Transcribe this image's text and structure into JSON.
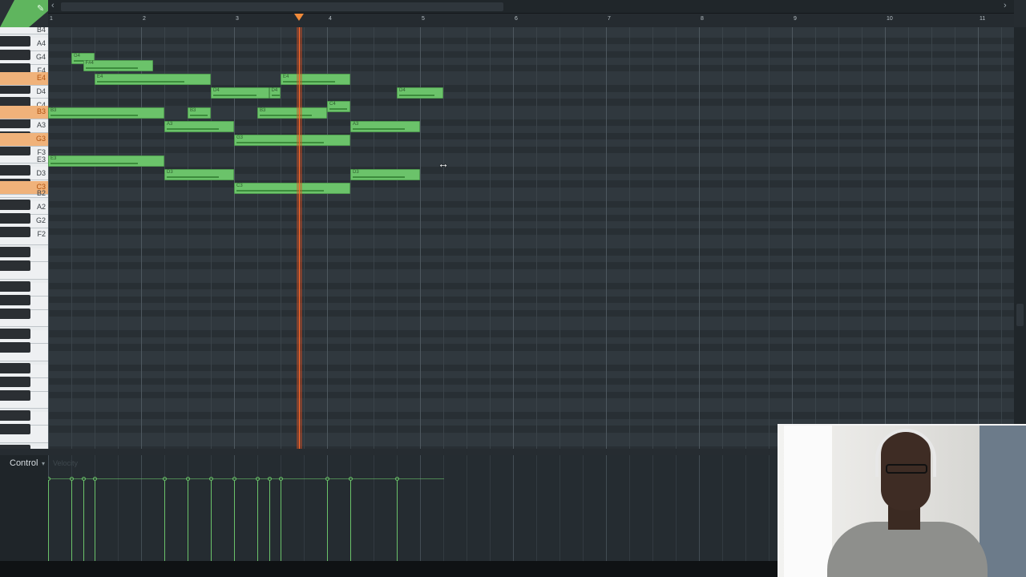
{
  "app": {
    "view": "Piano roll"
  },
  "ruler": {
    "bars": [
      "1",
      "2",
      "3",
      "4",
      "5",
      "6",
      "7",
      "8",
      "9",
      "10",
      "11"
    ]
  },
  "keyboard": {
    "labels": [
      {
        "key": "B4",
        "highlight": false
      },
      {
        "key": "A4",
        "highlight": false
      },
      {
        "key": "G4",
        "highlight": false
      },
      {
        "key": "F4",
        "highlight": false
      },
      {
        "key": "E4",
        "highlight": true
      },
      {
        "key": "D4",
        "highlight": false
      },
      {
        "key": "C4",
        "highlight": false
      },
      {
        "key": "B3",
        "highlight": true
      },
      {
        "key": "A3",
        "highlight": false
      },
      {
        "key": "G3",
        "highlight": true
      },
      {
        "key": "F3",
        "highlight": false
      },
      {
        "key": "E3",
        "highlight": false
      },
      {
        "key": "D3",
        "highlight": false
      },
      {
        "key": "C3",
        "highlight": true
      },
      {
        "key": "B2",
        "highlight": false
      },
      {
        "key": "A2",
        "highlight": false
      },
      {
        "key": "G2",
        "highlight": false
      },
      {
        "key": "F2",
        "highlight": false
      }
    ]
  },
  "notes": [
    {
      "label": "G4",
      "pitch": "G4",
      "start_beat": 0.25,
      "length_beats": 0.25
    },
    {
      "label": "F#4",
      "pitch": "F#4",
      "start_beat": 0.375,
      "length_beats": 0.75
    },
    {
      "label": "E4",
      "pitch": "E4",
      "start_beat": 0.5,
      "length_beats": 1.25
    },
    {
      "label": "E4",
      "pitch": "E4",
      "start_beat": 2.5,
      "length_beats": 0.75
    },
    {
      "label": "D4",
      "pitch": "D4",
      "start_beat": 1.75,
      "length_beats": 0.625
    },
    {
      "label": "D4",
      "pitch": "D4",
      "start_beat": 2.375,
      "length_beats": 0.125
    },
    {
      "label": "D4",
      "pitch": "D4",
      "start_beat": 3.75,
      "length_beats": 0.5
    },
    {
      "label": "C4",
      "pitch": "C4",
      "start_beat": 3.0,
      "length_beats": 0.25
    },
    {
      "label": "B3",
      "pitch": "B3",
      "start_beat": 0.0,
      "length_beats": 1.25
    },
    {
      "label": "B3",
      "pitch": "B3",
      "start_beat": 1.5,
      "length_beats": 0.25
    },
    {
      "label": "B3",
      "pitch": "B3",
      "start_beat": 2.25,
      "length_beats": 0.75
    },
    {
      "label": "A3",
      "pitch": "A3",
      "start_beat": 1.25,
      "length_beats": 0.75
    },
    {
      "label": "A3",
      "pitch": "A3",
      "start_beat": 3.25,
      "length_beats": 0.75
    },
    {
      "label": "G3",
      "pitch": "G3",
      "start_beat": 2.0,
      "length_beats": 1.25
    },
    {
      "label": "E3",
      "pitch": "E3",
      "start_beat": 0.0,
      "length_beats": 1.25
    },
    {
      "label": "D3",
      "pitch": "D3",
      "start_beat": 1.25,
      "length_beats": 0.75
    },
    {
      "label": "D3",
      "pitch": "D3",
      "start_beat": 3.25,
      "length_beats": 0.75
    },
    {
      "label": "C3",
      "pitch": "C3",
      "start_beat": 2.0,
      "length_beats": 1.25
    }
  ],
  "playhead": {
    "beat": 2.7
  },
  "control": {
    "label": "Control",
    "dropdown_icon": "chevron-down-icon",
    "parameter": "Velocity"
  },
  "colors": {
    "note": "#6bc36a",
    "playhead": "#ff6a2a",
    "key_highlight": "#f0b27a",
    "tool_corner": "#5fb55e"
  },
  "webcam": {
    "description_icon": "webcam-overlay"
  }
}
